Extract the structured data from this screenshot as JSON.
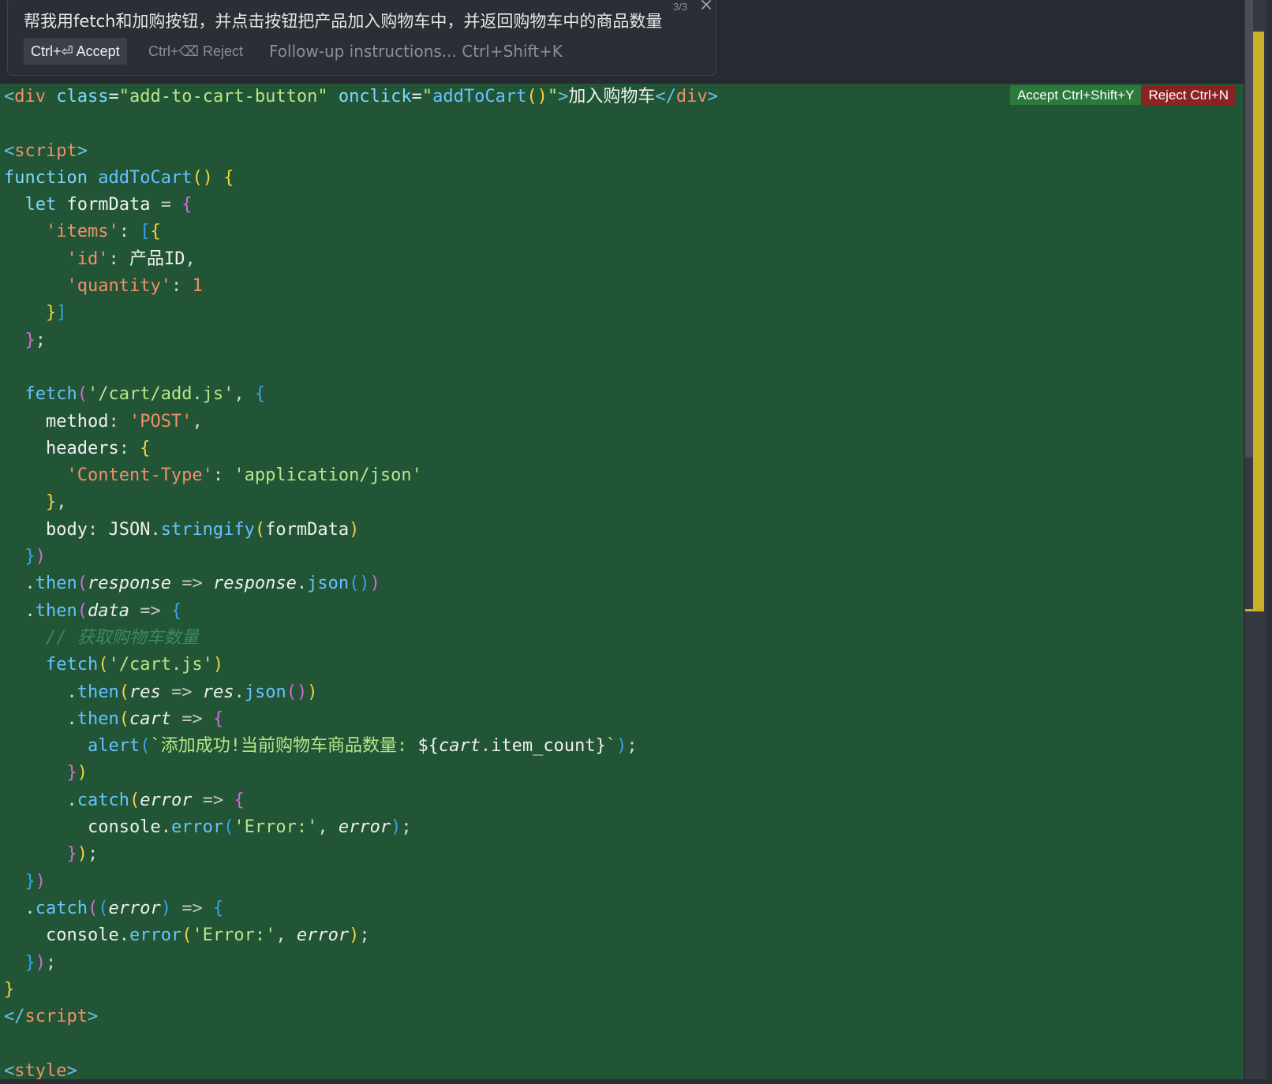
{
  "prompt": {
    "instruction": "帮我用fetch和加购按钮，并点击按钮把产品加入购物车中，并返回购物车中的商品数量",
    "counter": "3/3",
    "accept_label": "Ctrl+⏎ Accept",
    "reject_label": "Ctrl+⌫ Reject",
    "followup_placeholder": "Follow-up instructions... Ctrl+Shift+K"
  },
  "diff": {
    "accept_label": "Accept Ctrl+Shift+Y",
    "reject_label": "Reject Ctrl+N"
  },
  "colors": {
    "editor_bg": "#215535",
    "diff_accept": "#2b7a3b",
    "diff_reject": "#8c2323",
    "diff_marker": "#c9b02a"
  },
  "code_lines": [
    [
      [
        "t-tag",
        "<"
      ],
      [
        "t-tagname",
        "div"
      ],
      [
        "t-plain",
        " "
      ],
      [
        "t-attr",
        "class"
      ],
      [
        "t-plain",
        "="
      ],
      [
        "t-str",
        "\"add-to-cart-button\""
      ],
      [
        "t-plain",
        " "
      ],
      [
        "t-attr",
        "onclick"
      ],
      [
        "t-plain",
        "="
      ],
      [
        "t-str",
        "\""
      ],
      [
        "t-fn",
        "addToCart"
      ],
      [
        "t-b1",
        "()"
      ],
      [
        "t-str",
        "\""
      ],
      [
        "t-tag",
        ">"
      ],
      [
        "t-cn",
        "加入购物车"
      ],
      [
        "t-tag",
        "</"
      ],
      [
        "t-tagname",
        "div"
      ],
      [
        "t-tag",
        ">"
      ]
    ],
    [],
    [
      [
        "t-tag",
        "<"
      ],
      [
        "t-tagname",
        "script"
      ],
      [
        "t-tag",
        ">"
      ]
    ],
    [
      [
        "t-kw",
        "function"
      ],
      [
        "t-plain",
        " "
      ],
      [
        "t-fn",
        "addToCart"
      ],
      [
        "t-b1",
        "()"
      ],
      [
        "t-plain",
        " "
      ],
      [
        "t-b1",
        "{"
      ]
    ],
    [
      [
        "t-plain",
        "  "
      ],
      [
        "t-kw",
        "let"
      ],
      [
        "t-plain",
        " formData "
      ],
      [
        "t-op",
        "="
      ],
      [
        "t-plain",
        " "
      ],
      [
        "t-b2",
        "{"
      ]
    ],
    [
      [
        "t-plain",
        "    "
      ],
      [
        "t-key",
        "'items'"
      ],
      [
        "t-punct",
        ": "
      ],
      [
        "t-b3",
        "["
      ],
      [
        "t-b1",
        "{"
      ]
    ],
    [
      [
        "t-plain",
        "      "
      ],
      [
        "t-key",
        "'id'"
      ],
      [
        "t-punct",
        ": "
      ],
      [
        "t-cn",
        "产品ID"
      ],
      [
        "t-punct",
        ","
      ]
    ],
    [
      [
        "t-plain",
        "      "
      ],
      [
        "t-key",
        "'quantity'"
      ],
      [
        "t-punct",
        ": "
      ],
      [
        "t-num",
        "1"
      ]
    ],
    [
      [
        "t-plain",
        "    "
      ],
      [
        "t-b1",
        "}"
      ],
      [
        "t-b3",
        "]"
      ]
    ],
    [
      [
        "t-plain",
        "  "
      ],
      [
        "t-b2",
        "}"
      ],
      [
        "t-punct",
        ";"
      ]
    ],
    [],
    [
      [
        "t-plain",
        "  "
      ],
      [
        "t-fn",
        "fetch"
      ],
      [
        "t-b2",
        "("
      ],
      [
        "t-str",
        "'/cart/add.js'"
      ],
      [
        "t-punct",
        ", "
      ],
      [
        "t-b3",
        "{"
      ]
    ],
    [
      [
        "t-plain",
        "    method"
      ],
      [
        "t-punct",
        ": "
      ],
      [
        "t-key",
        "'POST'"
      ],
      [
        "t-punct",
        ","
      ]
    ],
    [
      [
        "t-plain",
        "    headers"
      ],
      [
        "t-punct",
        ": "
      ],
      [
        "t-b1",
        "{"
      ]
    ],
    [
      [
        "t-plain",
        "      "
      ],
      [
        "t-key",
        "'Content-Type'"
      ],
      [
        "t-punct",
        ": "
      ],
      [
        "t-str",
        "'application/json'"
      ]
    ],
    [
      [
        "t-plain",
        "    "
      ],
      [
        "t-b1",
        "}"
      ],
      [
        "t-punct",
        ","
      ]
    ],
    [
      [
        "t-plain",
        "    body"
      ],
      [
        "t-punct",
        ": "
      ],
      [
        "t-plain",
        "JSON"
      ],
      [
        "t-punct",
        "."
      ],
      [
        "t-fn",
        "stringify"
      ],
      [
        "t-b1",
        "("
      ],
      [
        "t-plain",
        "formData"
      ],
      [
        "t-b1",
        ")"
      ]
    ],
    [
      [
        "t-plain",
        "  "
      ],
      [
        "t-b3",
        "}"
      ],
      [
        "t-b2",
        ")"
      ]
    ],
    [
      [
        "t-plain",
        "  "
      ],
      [
        "t-punct",
        "."
      ],
      [
        "t-fn",
        "then"
      ],
      [
        "t-b2",
        "("
      ],
      [
        "t-param",
        "response"
      ],
      [
        "t-plain",
        " "
      ],
      [
        "t-op",
        "=>"
      ],
      [
        "t-plain",
        " "
      ],
      [
        "t-param",
        "response"
      ],
      [
        "t-punct",
        "."
      ],
      [
        "t-fn",
        "json"
      ],
      [
        "t-b3",
        "()"
      ],
      [
        "t-b2",
        ")"
      ]
    ],
    [
      [
        "t-plain",
        "  "
      ],
      [
        "t-punct",
        "."
      ],
      [
        "t-fn",
        "then"
      ],
      [
        "t-b2",
        "("
      ],
      [
        "t-param",
        "data"
      ],
      [
        "t-plain",
        " "
      ],
      [
        "t-op",
        "=>"
      ],
      [
        "t-plain",
        " "
      ],
      [
        "t-b3",
        "{"
      ]
    ],
    [
      [
        "t-plain",
        "    "
      ],
      [
        "t-comment",
        "// 获取购物车数量"
      ]
    ],
    [
      [
        "t-plain",
        "    "
      ],
      [
        "t-fn",
        "fetch"
      ],
      [
        "t-b1",
        "("
      ],
      [
        "t-str",
        "'/cart.js'"
      ],
      [
        "t-b1",
        ")"
      ]
    ],
    [
      [
        "t-plain",
        "      "
      ],
      [
        "t-punct",
        "."
      ],
      [
        "t-fn",
        "then"
      ],
      [
        "t-b1",
        "("
      ],
      [
        "t-param",
        "res"
      ],
      [
        "t-plain",
        " "
      ],
      [
        "t-op",
        "=>"
      ],
      [
        "t-plain",
        " "
      ],
      [
        "t-param",
        "res"
      ],
      [
        "t-punct",
        "."
      ],
      [
        "t-fn",
        "json"
      ],
      [
        "t-b2",
        "()"
      ],
      [
        "t-b1",
        ")"
      ]
    ],
    [
      [
        "t-plain",
        "      "
      ],
      [
        "t-punct",
        "."
      ],
      [
        "t-fn",
        "then"
      ],
      [
        "t-b1",
        "("
      ],
      [
        "t-param",
        "cart"
      ],
      [
        "t-plain",
        " "
      ],
      [
        "t-op",
        "=>"
      ],
      [
        "t-plain",
        " "
      ],
      [
        "t-b2",
        "{"
      ]
    ],
    [
      [
        "t-plain",
        "        "
      ],
      [
        "t-fn",
        "alert"
      ],
      [
        "t-b3",
        "("
      ],
      [
        "t-tmpl",
        "`添加成功!当前购物车商品数量: "
      ],
      [
        "t-plain",
        "${"
      ],
      [
        "t-param",
        "cart"
      ],
      [
        "t-punct",
        "."
      ],
      [
        "t-plain",
        "item_count}"
      ],
      [
        "t-tmpl",
        "`"
      ],
      [
        "t-b3",
        ")"
      ],
      [
        "t-punct",
        ";"
      ]
    ],
    [
      [
        "t-plain",
        "      "
      ],
      [
        "t-b2",
        "}"
      ],
      [
        "t-b1",
        ")"
      ]
    ],
    [
      [
        "t-plain",
        "      "
      ],
      [
        "t-punct",
        "."
      ],
      [
        "t-fn",
        "catch"
      ],
      [
        "t-b1",
        "("
      ],
      [
        "t-param",
        "error"
      ],
      [
        "t-plain",
        " "
      ],
      [
        "t-op",
        "=>"
      ],
      [
        "t-plain",
        " "
      ],
      [
        "t-b2",
        "{"
      ]
    ],
    [
      [
        "t-plain",
        "        console"
      ],
      [
        "t-punct",
        "."
      ],
      [
        "t-fn",
        "error"
      ],
      [
        "t-b3",
        "("
      ],
      [
        "t-str",
        "'Error:'"
      ],
      [
        "t-punct",
        ", "
      ],
      [
        "t-param",
        "error"
      ],
      [
        "t-b3",
        ")"
      ],
      [
        "t-punct",
        ";"
      ]
    ],
    [
      [
        "t-plain",
        "      "
      ],
      [
        "t-b2",
        "}"
      ],
      [
        "t-b1",
        ")"
      ],
      [
        "t-punct",
        ";"
      ]
    ],
    [
      [
        "t-plain",
        "  "
      ],
      [
        "t-b3",
        "}"
      ],
      [
        "t-b2",
        ")"
      ]
    ],
    [
      [
        "t-plain",
        "  "
      ],
      [
        "t-punct",
        "."
      ],
      [
        "t-fn",
        "catch"
      ],
      [
        "t-b2",
        "("
      ],
      [
        "t-b3",
        "("
      ],
      [
        "t-param",
        "error"
      ],
      [
        "t-b3",
        ")"
      ],
      [
        "t-plain",
        " "
      ],
      [
        "t-op",
        "=>"
      ],
      [
        "t-plain",
        " "
      ],
      [
        "t-b3",
        "{"
      ]
    ],
    [
      [
        "t-plain",
        "    console"
      ],
      [
        "t-punct",
        "."
      ],
      [
        "t-fn",
        "error"
      ],
      [
        "t-b1",
        "("
      ],
      [
        "t-str",
        "'Error:'"
      ],
      [
        "t-punct",
        ", "
      ],
      [
        "t-param",
        "error"
      ],
      [
        "t-b1",
        ")"
      ],
      [
        "t-punct",
        ";"
      ]
    ],
    [
      [
        "t-plain",
        "  "
      ],
      [
        "t-b3",
        "}"
      ],
      [
        "t-b2",
        ")"
      ],
      [
        "t-punct",
        ";"
      ]
    ],
    [
      [
        "t-b1",
        "}"
      ]
    ],
    [
      [
        "t-tag",
        "</"
      ],
      [
        "t-tagname",
        "script"
      ],
      [
        "t-tag",
        ">"
      ]
    ],
    [],
    [
      [
        "t-tag",
        "<"
      ],
      [
        "t-tagname",
        "style"
      ],
      [
        "t-tag",
        ">"
      ]
    ]
  ]
}
